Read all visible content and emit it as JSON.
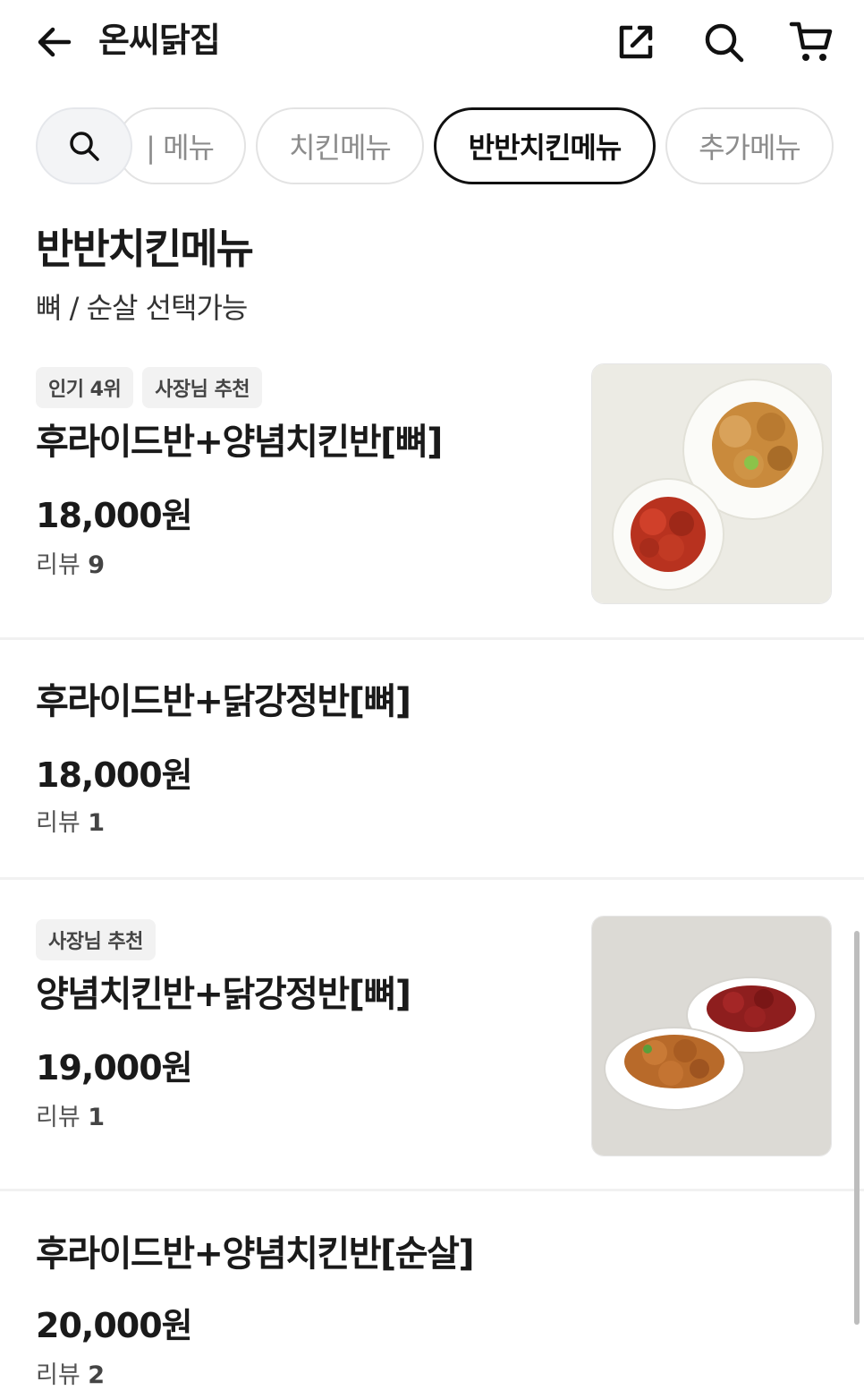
{
  "header": {
    "title": "온씨닭집"
  },
  "chips": {
    "cut": "| 메뉴",
    "chicken": "치킨메뉴",
    "half": "반반치킨메뉴",
    "extra": "추가메뉴"
  },
  "section": {
    "title": "반반치킨메뉴",
    "description": "뼈 / 순살 선택가능"
  },
  "items": [
    {
      "badges": [
        "인기 4위",
        "사장님 추천"
      ],
      "name": "후라이드반+양념치킨반[뼈]",
      "price": "18,000원",
      "review_label": "리뷰",
      "review_count": "9"
    },
    {
      "name": "후라이드반+닭강정반[뼈]",
      "price": "18,000원",
      "review_label": "리뷰",
      "review_count": "1"
    },
    {
      "badges": [
        "사장님 추천"
      ],
      "name": "양념치킨반+닭강정반[뼈]",
      "price": "19,000원",
      "review_label": "리뷰",
      "review_count": "1"
    },
    {
      "name": "후라이드반+양념치킨반[순살]",
      "price": "20,000원",
      "review_label": "리뷰",
      "review_count": "2"
    }
  ],
  "colors": {
    "text": "#1a1a1a",
    "chip_border": "#e3e3e3",
    "chip_active_border": "#111111",
    "badge_bg": "#f2f2f2"
  },
  "icons": [
    "back-arrow-icon",
    "share-icon",
    "search-icon",
    "cart-icon"
  ]
}
